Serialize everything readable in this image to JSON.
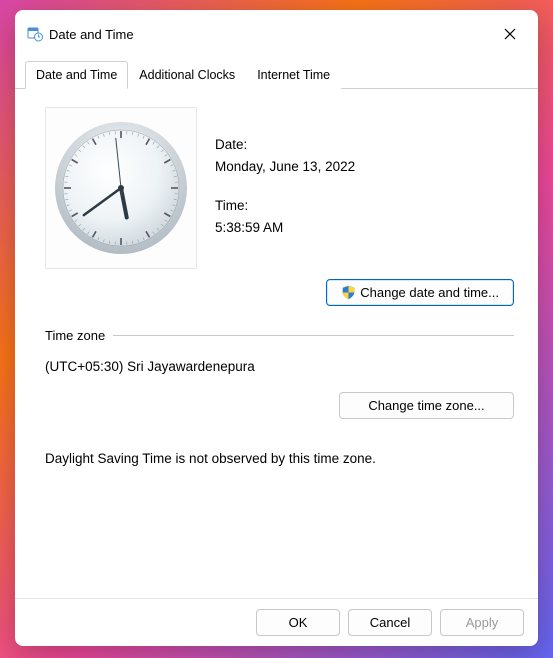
{
  "window": {
    "title": "Date and Time"
  },
  "tabs": [
    {
      "label": "Date and Time"
    },
    {
      "label": "Additional Clocks"
    },
    {
      "label": "Internet Time"
    }
  ],
  "date_label": "Date:",
  "date_value": "Monday, June 13, 2022",
  "time_label": "Time:",
  "time_value": "5:38:59 AM",
  "clock": {
    "h": 5,
    "m": 38,
    "s": 59
  },
  "change_dt_label": "Change date and time...",
  "tz_section_label": "Time zone",
  "tz_value": "(UTC+05:30) Sri Jayawardenepura",
  "change_tz_label": "Change time zone...",
  "dst_note": "Daylight Saving Time is not observed by this time zone.",
  "footer": {
    "ok": "OK",
    "cancel": "Cancel",
    "apply": "Apply"
  }
}
